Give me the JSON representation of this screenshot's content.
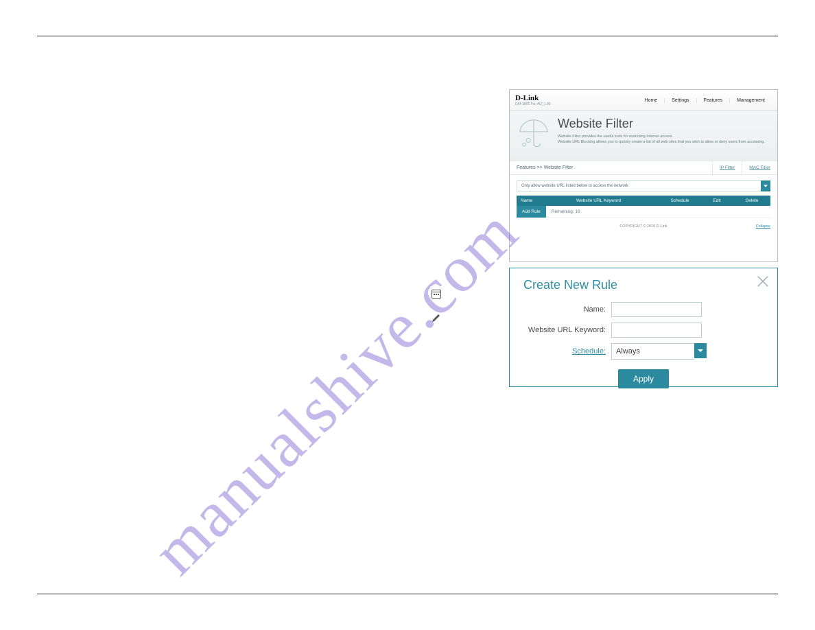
{
  "watermark": "manualshive.com",
  "inline_icons": {
    "calendar": "calendar-icon",
    "pencil": "pencil-icon"
  },
  "screenshot": {
    "brand": "D-Link",
    "model": "DIR-3800   Fw: AU_1.00",
    "nav": [
      "Home",
      "Settings",
      "Features",
      "Management"
    ],
    "hero_title": "Website Filter",
    "hero_desc_line1": "Website Filter provides the useful tools for restricting Internet access.",
    "hero_desc_line2": "Website URL Blocking allows you to quickly create a list of all web sites that you wish to allow or deny users from accessing.",
    "crumbs": "Features >> Website Filter",
    "tab_ip": "IP Filter",
    "tab_mac": "MAC Filter",
    "dropdown_text": "Only allow website URL listed below to access the network",
    "thead": {
      "c1": "Name",
      "c2": "Website URL Keyword",
      "c3": "Schedule",
      "c4": "Edit",
      "c5": "Delete"
    },
    "add_rule": "Add Rule",
    "remaining": "Remaining: 16",
    "copyright": "COPYRIGHT © 2016 D-Link",
    "collapse": "Collapse"
  },
  "modal": {
    "title": "Create New Rule",
    "name_label": "Name:",
    "url_label": "Website URL Keyword:",
    "schedule_label": "Schedule:",
    "schedule_value": "Always",
    "apply": "Apply"
  }
}
